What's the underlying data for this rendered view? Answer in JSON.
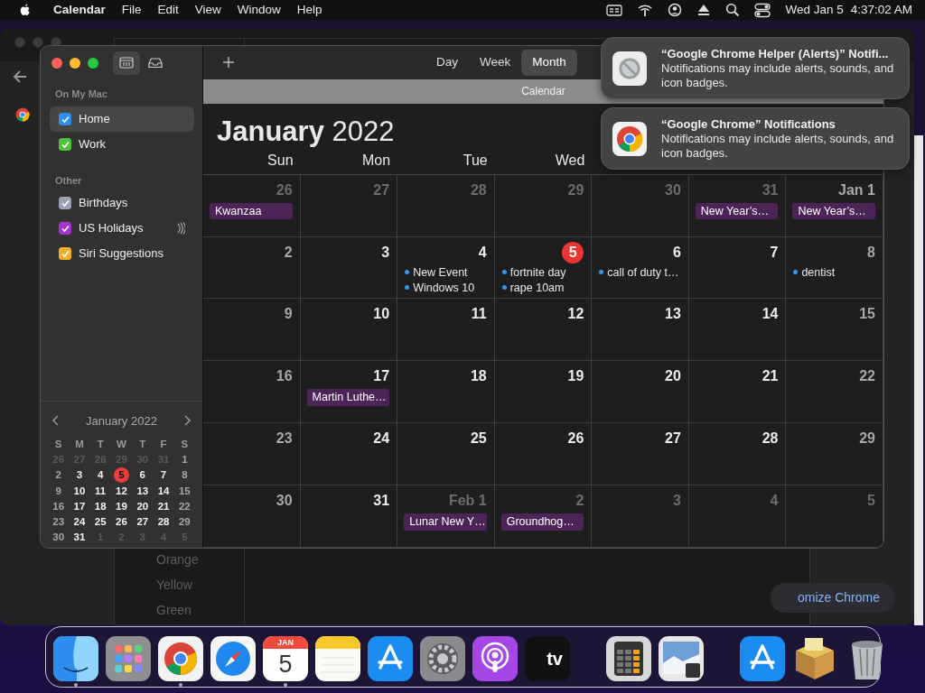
{
  "menu_bar": {
    "app_name": "Calendar",
    "menus": [
      "File",
      "Edit",
      "View",
      "Window",
      "Help"
    ],
    "date": "Wed Jan 5",
    "time": "4:37:02 AM"
  },
  "background_window": {
    "list_items": [
      "Orange",
      "Yellow",
      "Green"
    ],
    "button": "omize Chrome"
  },
  "calendar_window": {
    "sidebar_buttons": [
      {
        "kind": "calendars",
        "selected": true
      },
      {
        "kind": "inbox",
        "selected": false
      }
    ],
    "groups": [
      {
        "heading": "On My Mac",
        "items": [
          {
            "label": "Home",
            "checked": true,
            "color": "#2f8cf0",
            "selected": true,
            "subscribed": false
          },
          {
            "label": "Work",
            "checked": true,
            "color": "#4fc236",
            "selected": false,
            "subscribed": false
          }
        ]
      },
      {
        "heading": "Other",
        "items": [
          {
            "label": "Birthdays",
            "checked": true,
            "color": "#9ca3b4",
            "selected": false,
            "subscribed": false
          },
          {
            "label": "US Holidays",
            "checked": true,
            "color": "#a433d0",
            "selected": false,
            "subscribed": true
          },
          {
            "label": "Siri Suggestions",
            "checked": true,
            "color": "#f0b12a",
            "selected": false,
            "subscribed": false
          }
        ]
      }
    ],
    "mini_calendar": {
      "title": "January 2022",
      "weekdays": [
        "S",
        "M",
        "T",
        "W",
        "T",
        "F",
        "S"
      ],
      "weeks": [
        [
          {
            "day": "26",
            "in_month": false,
            "today": false
          },
          {
            "day": "27",
            "in_month": false,
            "today": false
          },
          {
            "day": "28",
            "in_month": false,
            "today": false
          },
          {
            "day": "29",
            "in_month": false,
            "today": false
          },
          {
            "day": "30",
            "in_month": false,
            "today": false
          },
          {
            "day": "31",
            "in_month": false,
            "today": false
          },
          {
            "day": "1",
            "in_month": true,
            "today": false
          }
        ],
        [
          {
            "day": "2",
            "in_month": true,
            "today": false
          },
          {
            "day": "3",
            "in_month": true,
            "today": false
          },
          {
            "day": "4",
            "in_month": true,
            "today": false
          },
          {
            "day": "5",
            "in_month": true,
            "today": true
          },
          {
            "day": "6",
            "in_month": true,
            "today": false
          },
          {
            "day": "7",
            "in_month": true,
            "today": false
          },
          {
            "day": "8",
            "in_month": true,
            "today": false
          }
        ],
        [
          {
            "day": "9",
            "in_month": true,
            "today": false
          },
          {
            "day": "10",
            "in_month": true,
            "today": false
          },
          {
            "day": "11",
            "in_month": true,
            "today": false
          },
          {
            "day": "12",
            "in_month": true,
            "today": false
          },
          {
            "day": "13",
            "in_month": true,
            "today": false
          },
          {
            "day": "14",
            "in_month": true,
            "today": false
          },
          {
            "day": "15",
            "in_month": true,
            "today": false
          }
        ],
        [
          {
            "day": "16",
            "in_month": true,
            "today": false
          },
          {
            "day": "17",
            "in_month": true,
            "today": false
          },
          {
            "day": "18",
            "in_month": true,
            "today": false
          },
          {
            "day": "19",
            "in_month": true,
            "today": false
          },
          {
            "day": "20",
            "in_month": true,
            "today": false
          },
          {
            "day": "21",
            "in_month": true,
            "today": false
          },
          {
            "day": "22",
            "in_month": true,
            "today": false
          }
        ],
        [
          {
            "day": "23",
            "in_month": true,
            "today": false
          },
          {
            "day": "24",
            "in_month": true,
            "today": false
          },
          {
            "day": "25",
            "in_month": true,
            "today": false
          },
          {
            "day": "26",
            "in_month": true,
            "today": false
          },
          {
            "day": "27",
            "in_month": true,
            "today": false
          },
          {
            "day": "28",
            "in_month": true,
            "today": false
          },
          {
            "day": "29",
            "in_month": true,
            "today": false
          }
        ],
        [
          {
            "day": "30",
            "in_month": true,
            "today": false
          },
          {
            "day": "31",
            "in_month": true,
            "today": false
          },
          {
            "day": "1",
            "in_month": false,
            "today": false
          },
          {
            "day": "2",
            "in_month": false,
            "today": false
          },
          {
            "day": "3",
            "in_month": false,
            "today": false
          },
          {
            "day": "4",
            "in_month": false,
            "today": false
          },
          {
            "day": "5",
            "in_month": false,
            "today": false
          }
        ]
      ]
    },
    "view_tabs": [
      {
        "label": "Day",
        "selected": false
      },
      {
        "label": "Week",
        "selected": false
      },
      {
        "label": "Month",
        "selected": true
      }
    ],
    "title": "Calendar",
    "month_title": "**January** 2022",
    "weekdays": [
      "Sun",
      "Mon",
      "Tue",
      "Wed"
    ],
    "weeks": [
      [
        {
          "day": "26",
          "in_month": false,
          "today": false,
          "events": [
            {
              "title": "Kwanzaa",
              "kind": "all_day"
            }
          ]
        },
        {
          "day": "27",
          "in_month": false,
          "today": false
        },
        {
          "day": "28",
          "in_month": false,
          "today": false
        },
        {
          "day": "29",
          "in_month": false,
          "today": false
        },
        {
          "day": "30",
          "in_month": false,
          "today": false
        },
        {
          "day": "31",
          "in_month": false,
          "today": false,
          "events": [
            {
              "title": "New Year’s…",
              "kind": "all_day"
            }
          ]
        },
        {
          "day": "Jan 1",
          "in_month": true,
          "today": false,
          "events": [
            {
              "title": "New Year’s…",
              "kind": "all_day"
            }
          ]
        }
      ],
      [
        {
          "day": "2",
          "in_month": true,
          "today": false
        },
        {
          "day": "3",
          "in_month": true,
          "today": false
        },
        {
          "day": "4",
          "in_month": true,
          "today": false,
          "events": [
            {
              "title": "New Event",
              "kind": "timed"
            },
            {
              "title": "Windows 10",
              "kind": "timed"
            }
          ]
        },
        {
          "day": "5",
          "in_month": true,
          "today": true,
          "events": [
            {
              "title": "fortnite day",
              "kind": "timed"
            },
            {
              "title": "rape 10am",
              "kind": "timed"
            }
          ]
        },
        {
          "day": "6",
          "in_month": true,
          "today": false,
          "events": [
            {
              "title": "call of duty t…",
              "kind": "timed"
            }
          ]
        },
        {
          "day": "7",
          "in_month": true,
          "today": false
        },
        {
          "day": "8",
          "in_month": true,
          "today": false,
          "events": [
            {
              "title": "dentist",
              "kind": "timed"
            }
          ]
        }
      ],
      [
        {
          "day": "9",
          "in_month": true,
          "today": false
        },
        {
          "day": "10",
          "in_month": true,
          "today": false
        },
        {
          "day": "11",
          "in_month": true,
          "today": false
        },
        {
          "day": "12",
          "in_month": true,
          "today": false
        },
        {
          "day": "13",
          "in_month": true,
          "today": false
        },
        {
          "day": "14",
          "in_month": true,
          "today": false
        },
        {
          "day": "15",
          "in_month": true,
          "today": false
        }
      ],
      [
        {
          "day": "16",
          "in_month": true,
          "today": false
        },
        {
          "day": "17",
          "in_month": true,
          "today": false,
          "events": [
            {
              "title": "Martin Luthe…",
              "kind": "all_day"
            }
          ]
        },
        {
          "day": "18",
          "in_month": true,
          "today": false
        },
        {
          "day": "19",
          "in_month": true,
          "today": false
        },
        {
          "day": "20",
          "in_month": true,
          "today": false
        },
        {
          "day": "21",
          "in_month": true,
          "today": false
        },
        {
          "day": "22",
          "in_month": true,
          "today": false
        }
      ],
      [
        {
          "day": "23",
          "in_month": true,
          "today": false
        },
        {
          "day": "24",
          "in_month": true,
          "today": false
        },
        {
          "day": "25",
          "in_month": true,
          "today": false
        },
        {
          "day": "26",
          "in_month": true,
          "today": false
        },
        {
          "day": "27",
          "in_month": true,
          "today": false
        },
        {
          "day": "28",
          "in_month": true,
          "today": false
        },
        {
          "day": "29",
          "in_month": true,
          "today": false
        }
      ],
      [
        {
          "day": "30",
          "in_month": true,
          "today": false
        },
        {
          "day": "31",
          "in_month": true,
          "today": false
        },
        {
          "day": "Feb 1",
          "in_month": false,
          "today": false,
          "events": [
            {
              "title": "Lunar New Y…",
              "kind": "all_day"
            }
          ]
        },
        {
          "day": "2",
          "in_month": false,
          "today": false,
          "events": [
            {
              "title": "Groundhog…",
              "kind": "all_day"
            }
          ]
        },
        {
          "day": "3",
          "in_month": false,
          "today": false
        },
        {
          "day": "4",
          "in_month": false,
          "today": false
        },
        {
          "day": "5",
          "in_month": false,
          "today": false
        }
      ]
    ]
  },
  "notifications": [
    {
      "kind": "blocked",
      "title": "“Google Chrome Helper (Alerts)” Notifi...",
      "body": "Notifications may include alerts, sounds, and icon badges."
    },
    {
      "kind": "browser",
      "title": "“Google Chrome” Notifications",
      "body": "Notifications may include alerts, sounds, and icon badges."
    }
  ],
  "dock": [
    {
      "kind": "finder",
      "running": true
    },
    {
      "kind": "launchpad"
    },
    {
      "kind": "browser",
      "running": true
    },
    {
      "kind": "compass"
    },
    {
      "kind": "calendar",
      "running": true,
      "month": "JAN",
      "day": "5"
    },
    {
      "kind": "notes"
    },
    {
      "kind": "appstore"
    },
    {
      "kind": "gear"
    },
    {
      "kind": "podcast"
    },
    {
      "kind": "tv",
      "label": "tv"
    },
    {
      "kind": "separator"
    },
    {
      "kind": "calculator"
    },
    {
      "kind": "photo"
    },
    {
      "kind": "separator"
    },
    {
      "kind": "appstore"
    },
    {
      "kind": "package"
    },
    {
      "kind": "trash"
    }
  ]
}
